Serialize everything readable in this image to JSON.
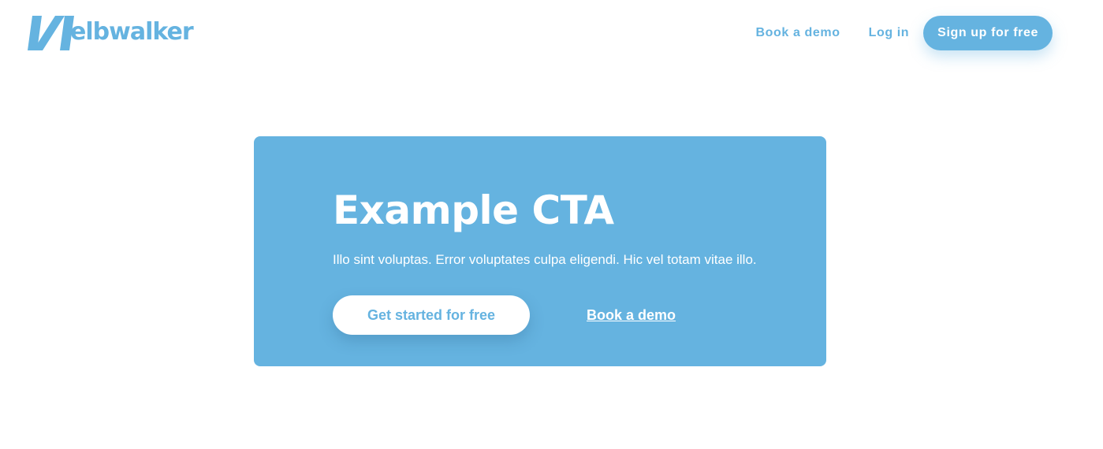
{
  "header": {
    "logo_text": "elbwalker",
    "nav": {
      "book_demo_label": "Book a demo",
      "login_label": "Log in",
      "signup_label": "Sign up for free"
    }
  },
  "cta": {
    "title": "Example CTA",
    "text": "Illo sint voluptas. Error voluptates culpa eligendi. Hic vel totam vitae illo.",
    "primary_label": "Get started for free",
    "secondary_label": "Book a demo"
  },
  "colors": {
    "brand": "#65b3e0",
    "background": "#ffffff",
    "button_text_on_brand": "#ffffff"
  },
  "icons": {
    "logo_mark": "elbwalker-logo-icon"
  }
}
